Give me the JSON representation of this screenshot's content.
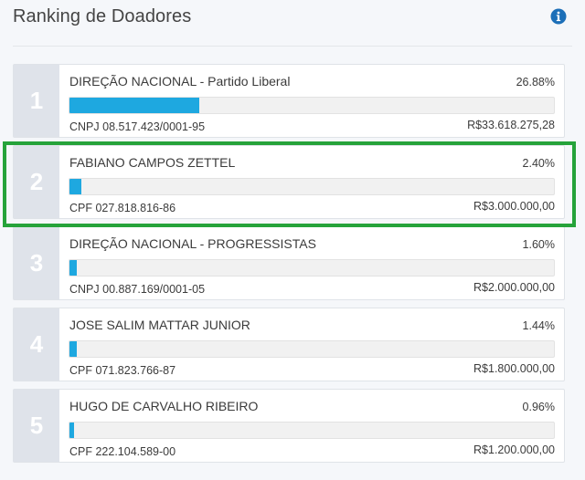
{
  "header": {
    "title": "Ranking de Doadores",
    "info_icon": "info-circle-icon"
  },
  "colors": {
    "bar": "#1ea8e0",
    "highlight": "#26a33a",
    "rank_bg": "#dfe3ea"
  },
  "donors": [
    {
      "rank": "1",
      "name": "DIREÇÃO NACIONAL - Partido Liberal",
      "percent_label": "26.88%",
      "share": 26.88,
      "document": "CNPJ 08.517.423/0001-95",
      "amount": "R$33.618.275,28"
    },
    {
      "rank": "2",
      "name": "FABIANO CAMPOS ZETTEL",
      "percent_label": "2.40%",
      "share": 2.4,
      "document": "CPF 027.818.816-86",
      "amount": "R$3.000.000,00"
    },
    {
      "rank": "3",
      "name": "DIREÇÃO NACIONAL - PROGRESSISTAS",
      "percent_label": "1.60%",
      "share": 1.6,
      "document": "CNPJ 00.887.169/0001-05",
      "amount": "R$2.000.000,00"
    },
    {
      "rank": "4",
      "name": "JOSE SALIM MATTAR JUNIOR",
      "percent_label": "1.44%",
      "share": 1.44,
      "document": "CPF 071.823.766-87",
      "amount": "R$1.800.000,00"
    },
    {
      "rank": "5",
      "name": "HUGO DE CARVALHO RIBEIRO",
      "percent_label": "0.96%",
      "share": 0.96,
      "document": "CPF 222.104.589-00",
      "amount": "R$1.200.000,00"
    }
  ]
}
